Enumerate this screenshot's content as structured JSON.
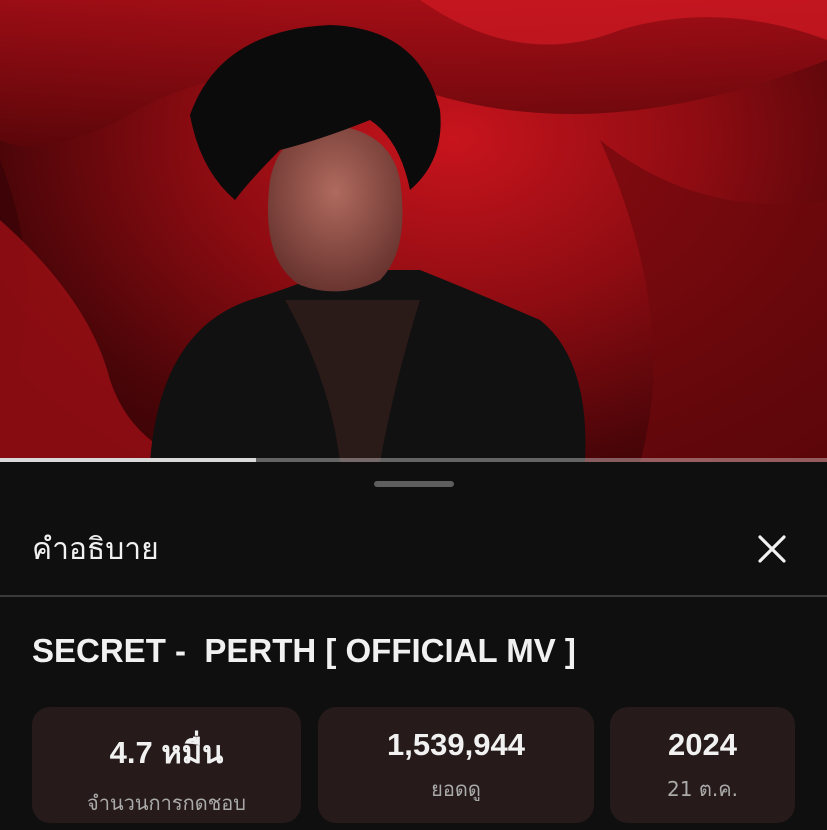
{
  "player": {
    "progress": 0.31
  },
  "description_panel": {
    "title": "คำอธิบาย",
    "close_icon": "close-icon",
    "video_title": "SECRET -  PERTH [ OFFICIAL MV ]",
    "stats": [
      {
        "value": "4.7 หมื่น",
        "label": "จำนวนการกดชอบ"
      },
      {
        "value": "1,539,944",
        "label": "ยอดดู"
      },
      {
        "value": "2024",
        "label": "21 ต.ค."
      }
    ]
  },
  "colors": {
    "background": "#0f0f0f",
    "stat_card": "#261a1a",
    "primary_text": "#f1f1f1",
    "secondary_text": "#aaaaaa"
  }
}
